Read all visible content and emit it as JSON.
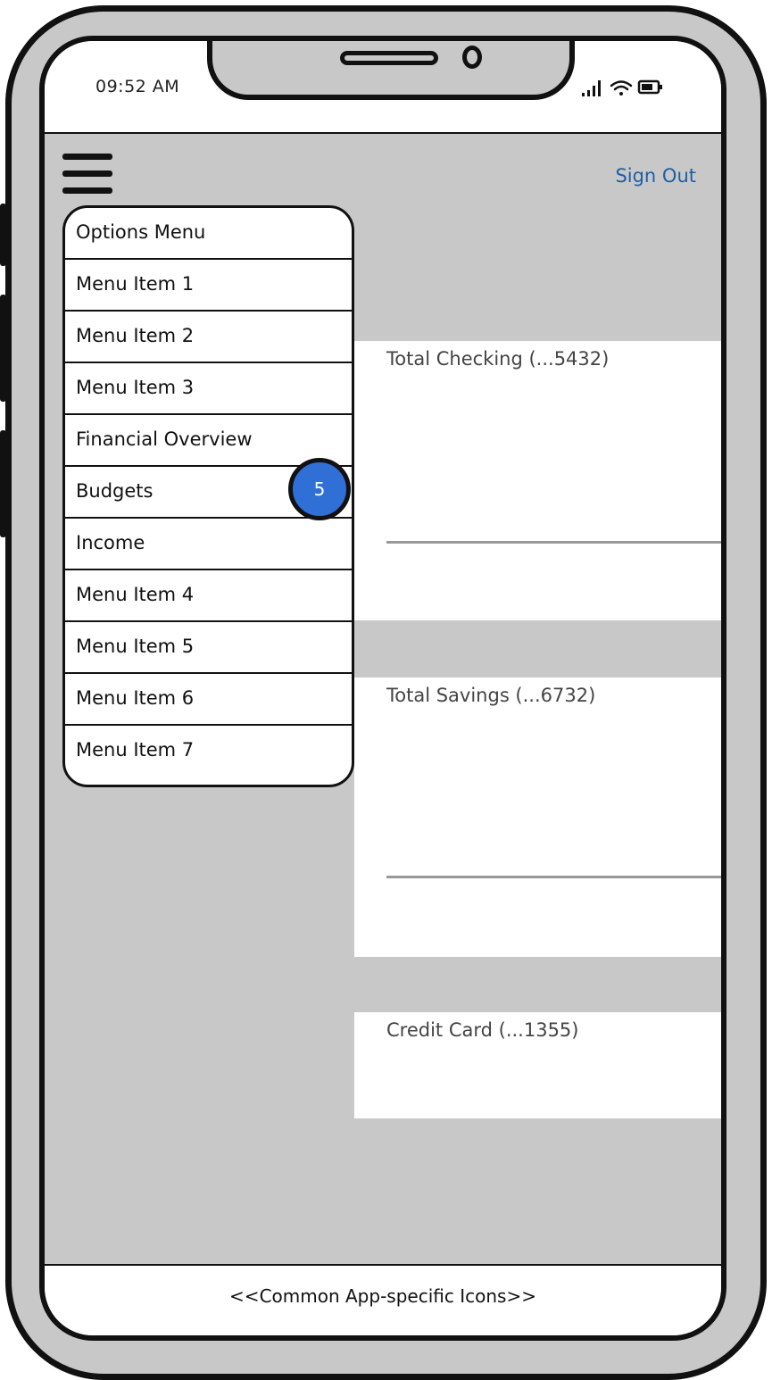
{
  "status_bar": {
    "time": "09:52 AM",
    "icons": [
      "signal-icon",
      "wifi-icon",
      "battery-icon"
    ]
  },
  "header": {
    "menu_icon": "hamburger-icon",
    "sign_out_label": "Sign Out"
  },
  "menu": {
    "title": "Options Menu",
    "items": [
      {
        "label": "Menu Item 1"
      },
      {
        "label": "Menu Item 2"
      },
      {
        "label": "Menu Item 3"
      },
      {
        "label": "Financial Overview"
      },
      {
        "label": "Budgets",
        "badge": "5"
      },
      {
        "label": "Income"
      },
      {
        "label": "Menu Item 4"
      },
      {
        "label": "Menu Item 5"
      },
      {
        "label": "Menu Item 6"
      },
      {
        "label": "Menu Item 7"
      }
    ]
  },
  "accounts": [
    {
      "label": "Total Checking  (...5432)"
    },
    {
      "label": "Total Savings  (...6732)"
    },
    {
      "label": "Credit Card  (...1355)"
    }
  ],
  "footer": {
    "label": "<<Common App-specific Icons>>"
  },
  "colors": {
    "accent": "#2f6fd6",
    "link": "#1f5fa6",
    "background": "#c8c8c8"
  }
}
